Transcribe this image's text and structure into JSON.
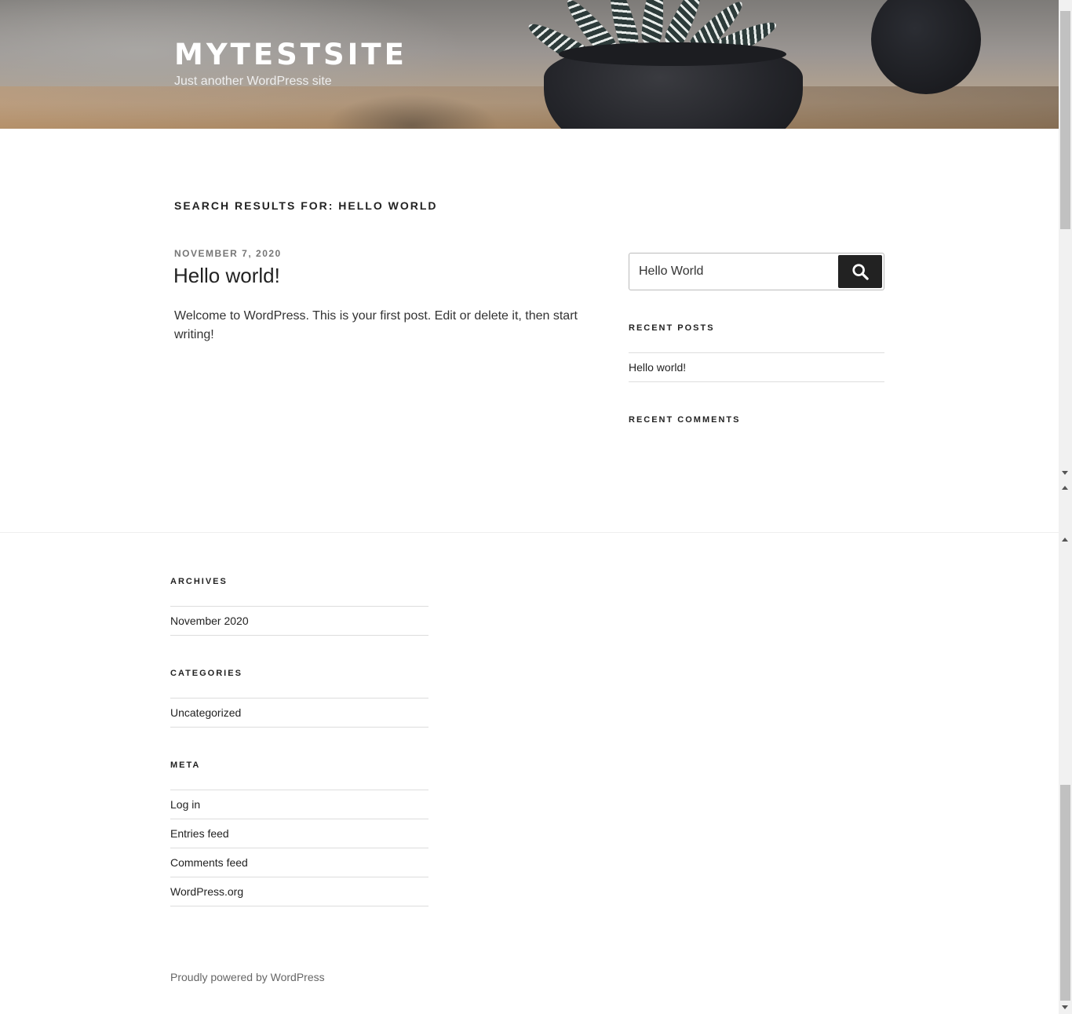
{
  "header": {
    "site_title": "MYTESTSITE",
    "site_description": "Just another WordPress site"
  },
  "main": {
    "page_title": "SEARCH RESULTS FOR: HELLO WORLD",
    "post": {
      "date": "NOVEMBER 7, 2020",
      "title": "Hello world!",
      "excerpt": "Welcome to WordPress. This is your first post. Edit or delete it, then start writing!"
    }
  },
  "sidebar": {
    "search": {
      "value": "Hello World",
      "button_icon": "search-icon"
    },
    "recent_posts": {
      "title": "RECENT POSTS",
      "items": [
        "Hello world!"
      ]
    },
    "recent_comments": {
      "title": "RECENT COMMENTS"
    }
  },
  "footer": {
    "archives": {
      "title": "ARCHIVES",
      "items": [
        "November 2020"
      ]
    },
    "categories": {
      "title": "CATEGORIES",
      "items": [
        "Uncategorized"
      ]
    },
    "meta": {
      "title": "META",
      "items": [
        "Log in",
        "Entries feed",
        "Comments feed",
        "WordPress.org"
      ]
    },
    "powered_by": "Proudly powered by WordPress"
  },
  "colors": {
    "text_dark": "#222222",
    "button_bg": "#222222",
    "border": "#dddddd"
  }
}
